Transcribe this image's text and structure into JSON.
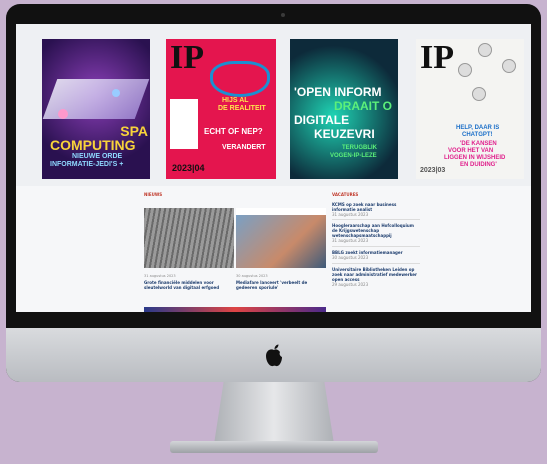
{
  "covers": [
    {
      "name": "spatial-computing-cover",
      "line1": "SPA",
      "line2": "COMPUTING",
      "line3": "NIEUWE ORDE",
      "line4": "INFORMATIE-JEDI'S +"
    },
    {
      "name": "ip-2023-04-cover",
      "masthead": "IP",
      "teaser1": "HIJS AL",
      "teaser2": "DE REALITEIT",
      "headline1": "ECHT OF NEP?",
      "headline2": "VERANDERT",
      "issue": "2023|04"
    },
    {
      "name": "open-informatie-cover",
      "line1": "'OPEN INFORM",
      "line2": "DRAAIT O",
      "line3": "DIGITALE",
      "line4": "KEUZEVRI",
      "line5": "TERUGBLIK",
      "line6": "VOGEN-IP-LEZE"
    },
    {
      "name": "ip-chatgpt-cover",
      "masthead": "IP",
      "headline1": "HELP, DAAR IS",
      "headline2": "CHATGPT!",
      "teaser1": "'DE KANSEN",
      "teaser2": "VOOR HET VAN",
      "teaser3": "LIGGEN IN WIJSHEID",
      "teaser4": "EN DUIDING'",
      "issue": "2023|03"
    }
  ],
  "sections": {
    "news": "NIEUWS",
    "vacancies": "VACATURES"
  },
  "news_cards": [
    {
      "date": "31 augustus 2023",
      "title": "Grote financiële middelen voor sleutelworld van digitaal erfgoed"
    },
    {
      "date": "30 augustus 2023",
      "title": "Mediafare lanceert 'verbeelt de gedeeren sporiuIe'"
    }
  ],
  "vacancies": [
    {
      "title": "KCMS op zoek naar business informatie analist",
      "date": "31 augustus 2023"
    },
    {
      "title": "Hoogleraarschap aan Hofcolloquium de Krijgswetenschap wetenschapsmaatschappij",
      "date": "31 augustus 2023"
    },
    {
      "title": "BBLG zoekt informatiemanager",
      "date": "30 augustus 2023"
    },
    {
      "title": "Universitaire Bibliotheken Leiden op zoek naar administratief medewerker open access",
      "date": "29 augustus 2023"
    }
  ],
  "colors": {
    "accent": "#c0392b",
    "link": "#1d3d6e",
    "background": "#c7b3cf"
  }
}
